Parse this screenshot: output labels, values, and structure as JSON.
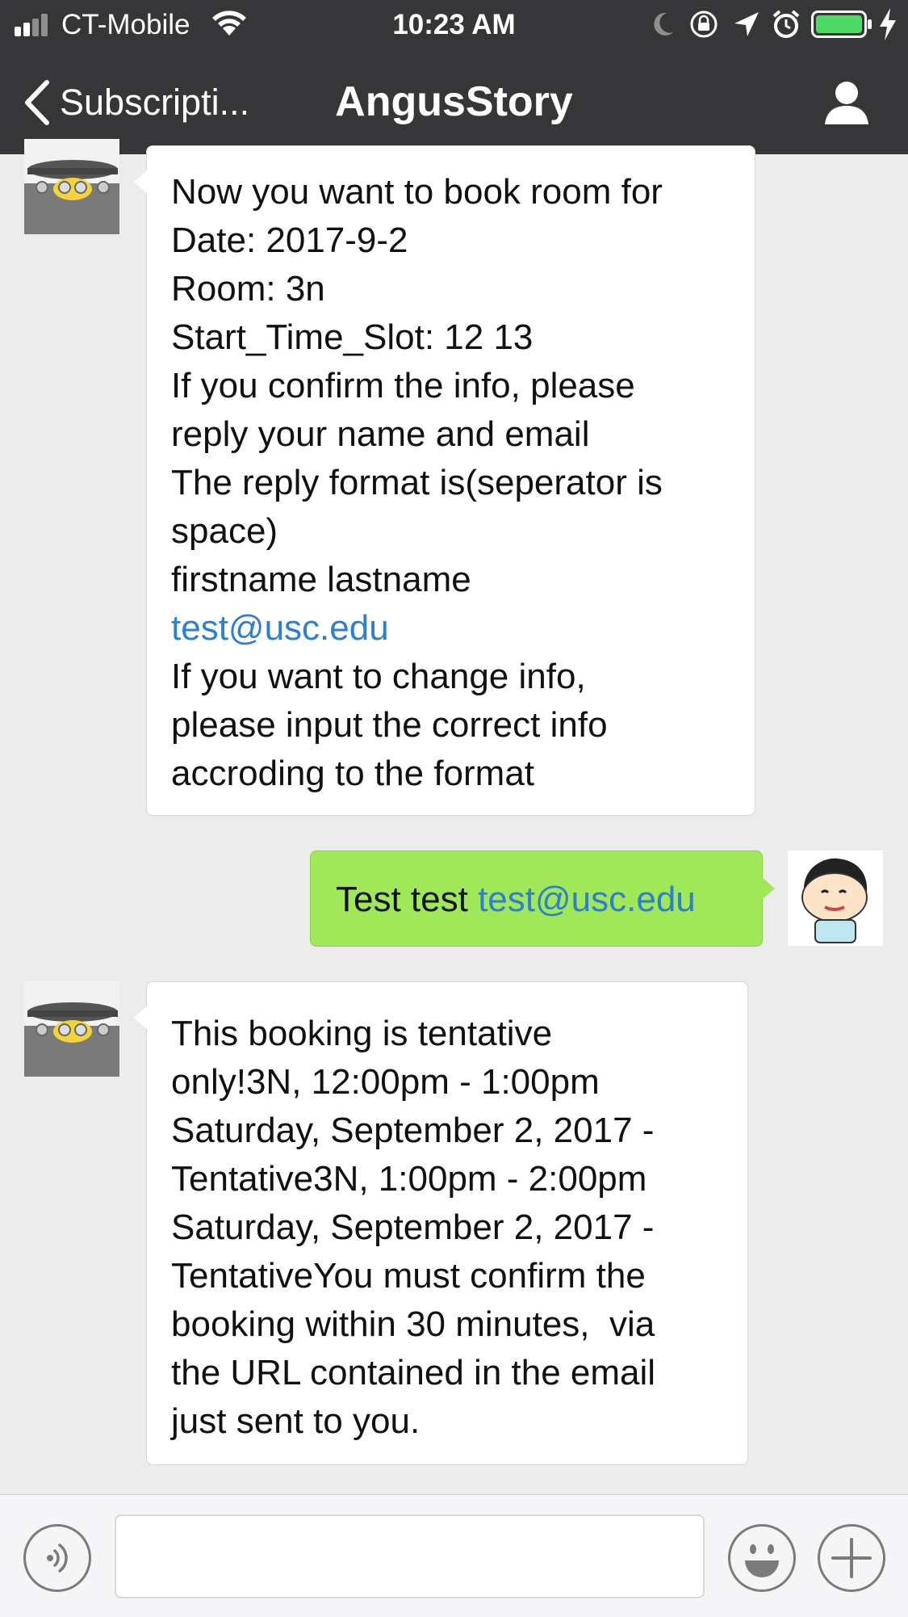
{
  "status_bar": {
    "carrier": "CT-Mobile",
    "time": "10:23 AM",
    "icons": [
      "signal-icon",
      "wifi-icon",
      "moon-icon",
      "rotation-lock-icon",
      "location-icon",
      "alarm-icon",
      "battery-icon",
      "charging-icon"
    ],
    "battery_color": "#4cd964"
  },
  "nav": {
    "back_label": "Subscripti...",
    "title": "AngusStory",
    "profile_icon": "person-icon"
  },
  "messages": [
    {
      "sender": "bot",
      "lines": [
        "Now you want to book room for",
        "Date: 2017-9-2",
        "Room: 3n",
        "Start_Time_Slot: 12 13",
        "If you confirm the info, please",
        "reply your name and email",
        "The reply format is(seperator is",
        "space)",
        "firstname lastname",
        "test@usc.edu",
        "If you want to change info,",
        "please input the correct info",
        "accroding to the format"
      ]
    },
    {
      "sender": "me",
      "text": "Test test ",
      "link": "test@usc.edu"
    },
    {
      "sender": "bot",
      "lines": [
        "This booking is tentative",
        "only!3N, 12:00pm - 1:00pm",
        "Saturday, September 2, 2017 -",
        "Tentative3N, 1:00pm - 2:00pm",
        "Saturday, September 2, 2017 -",
        "TentativeYou must confirm the",
        "booking within 30 minutes,  via",
        "the URL contained in the email",
        "just sent to you."
      ]
    }
  ],
  "colors": {
    "nav_bg": "#363638",
    "chat_bg": "#ececec",
    "my_bubble": "#a0e75a",
    "link": "#2d7fcf"
  },
  "input_bar": {
    "placeholder": "",
    "voice_icon": "voice-icon",
    "emoji_icon": "emoji-icon",
    "plus_icon": "plus-icon"
  }
}
